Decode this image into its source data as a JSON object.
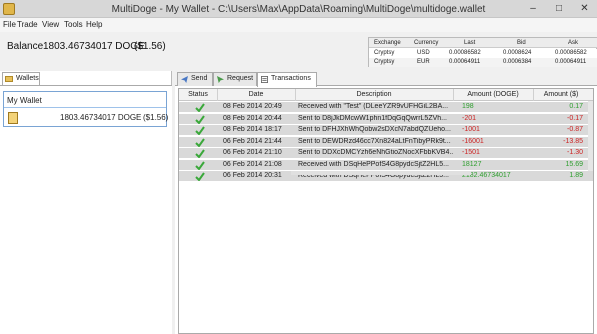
{
  "window": {
    "title": "MultiDoge - My Wallet - C:\\Users\\Max\\AppData\\Roaming\\MultiDoge\\multidoge.wallet",
    "controls": [
      "–",
      "□",
      "✕"
    ]
  },
  "menu": [
    "File",
    "Trade",
    "View",
    "Tools",
    "Help"
  ],
  "balance": {
    "label": "Balance",
    "amount": "1803.46734017 DOGE",
    "usd": "($1.56)"
  },
  "exchange": {
    "headers": [
      "Exchange",
      "Currency",
      "Last",
      "Bid",
      "Ask"
    ],
    "rows": [
      [
        "Cryptsy",
        "USD",
        "0.00086582",
        "0.0008624",
        "0.00086582"
      ],
      [
        "Cryptsy",
        "EUR",
        "0.00064911",
        "0.0006384",
        "0.00064911"
      ]
    ]
  },
  "wallets": {
    "tab_label": "Wallets",
    "name": "My Wallet",
    "amount": "1803.46734017 DOGE",
    "usd": "($1.56)"
  },
  "tabs": [
    "Send",
    "Request",
    "Transactions"
  ],
  "transactions": {
    "headers": [
      "Status",
      "Date",
      "Description",
      "Amount (DOGE)",
      "Amount ($)"
    ],
    "rows": [
      {
        "date": "08 Feb 2014 20:49",
        "desc": "Received with \"Test\" (DLeeYZR9vUFHGiL2BA...",
        "amount": "198",
        "usd": "0.17",
        "positive": true
      },
      {
        "date": "08 Feb 2014 20:44",
        "desc": "Sent to D8jJkDMcwW1phn1fDqGqQwrrL5ZVh...",
        "amount": "-201",
        "usd": "-0.17",
        "positive": false
      },
      {
        "date": "08 Feb 2014 18:17",
        "desc": "Sent to DFHJXhWhQobw2sDXcN7abdQZUeho...",
        "amount": "-1001",
        "usd": "-0.87",
        "positive": false
      },
      {
        "date": "06 Feb 2014 21:44",
        "desc": "Sent to DEWDRzd46cc7Xn824aLtFnTibyPRk9t...",
        "amount": "-16001",
        "usd": "-13.85",
        "positive": false
      },
      {
        "date": "06 Feb 2014 21:10",
        "desc": "Sent to DDXcDMCYzh6eNhGtioZNocXFbbKVB4...",
        "amount": "-1501",
        "usd": "-1.30",
        "positive": false
      },
      {
        "date": "06 Feb 2014 21:08",
        "desc": "Received with DSqHePPofS4G8pydcSjtZ2HL5...",
        "amount": "18127",
        "usd": "15.69",
        "positive": true
      },
      {
        "date": "06 Feb 2014 20:31",
        "desc": "Received with DSqHePPofS4G8pydcSjtZ2HL5...",
        "amount": "2182.46734017",
        "usd": "1.89",
        "positive": true
      }
    ]
  },
  "colors": {
    "positive": "#2e9e2e",
    "negative": "#cc2222",
    "check": "#3aa83a",
    "selected_row": "#d9d9d9"
  }
}
